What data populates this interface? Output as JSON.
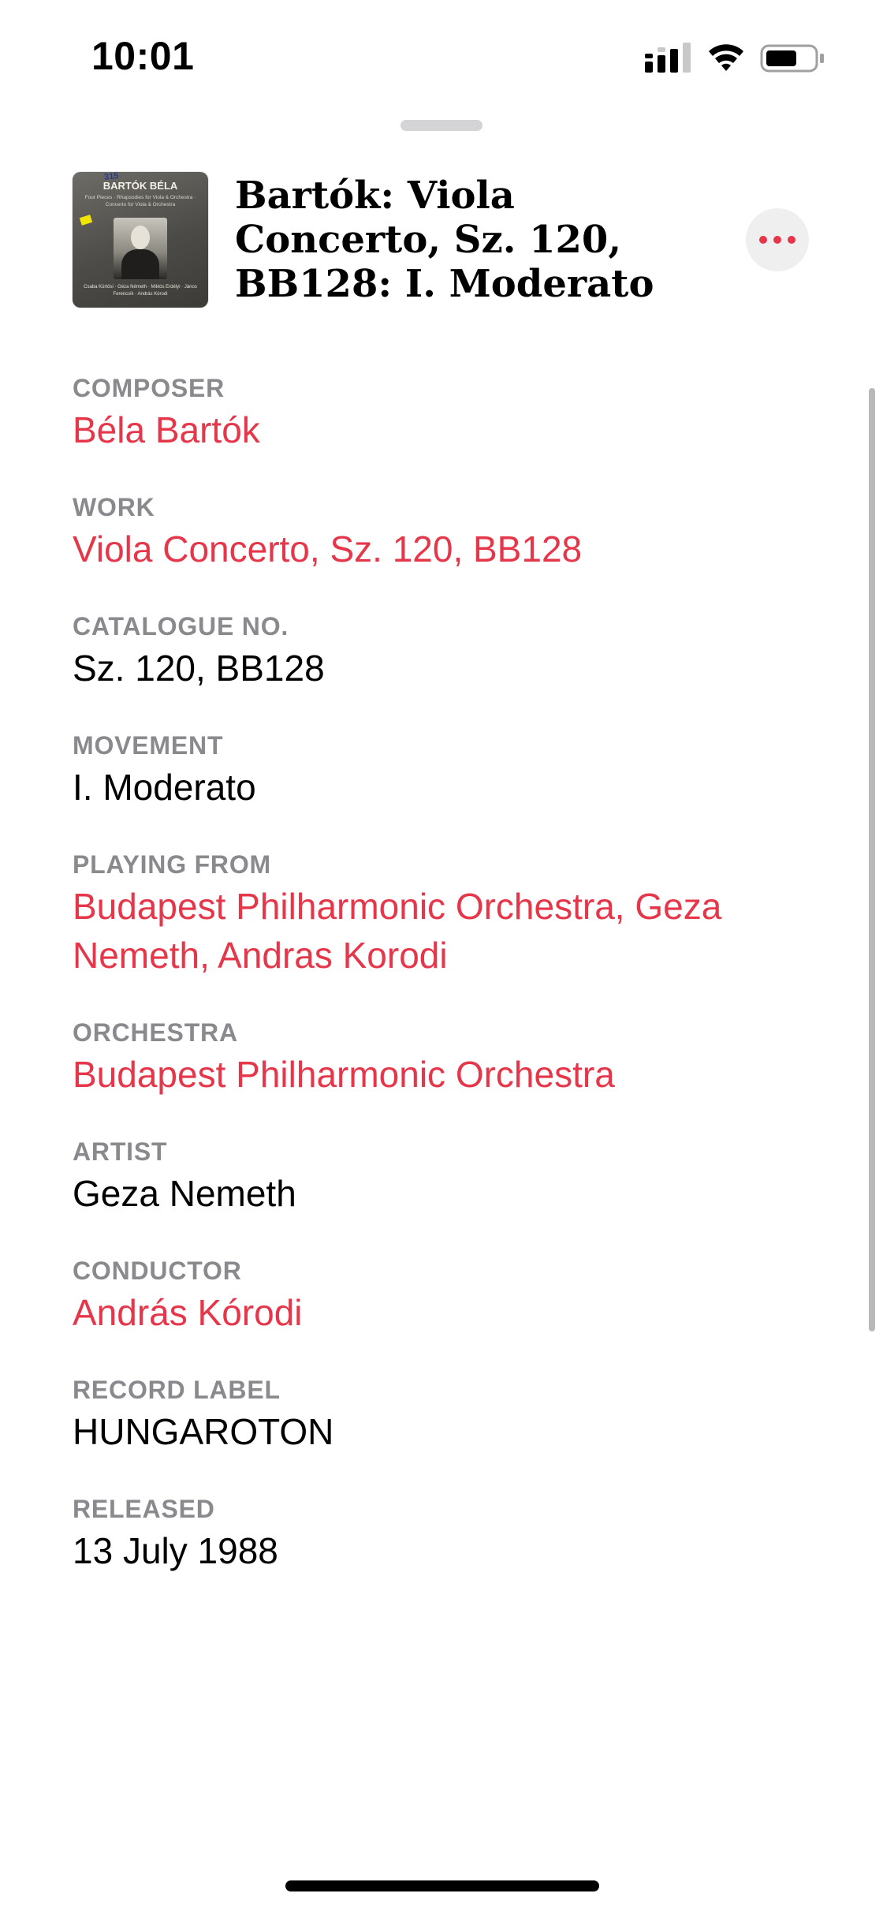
{
  "status_bar": {
    "time": "10:01",
    "icons": [
      "cellular-signal-icon",
      "wifi-icon",
      "battery-icon"
    ]
  },
  "artwork": {
    "header_text": "BARTÓK BÉLA",
    "sub_text": "Four Pieces · Rhapsodies for Viola & Orchestra · Concerto for Viola & Orchestra",
    "credits_text": "Csaba Kürtösi · Géza Németh · Miklós Erdélyi · János Ferencsik · András Kórodi",
    "scribble": "315"
  },
  "header": {
    "title": "Bartók: Viola Concerto, Sz. 120, BB128: I. Moderato",
    "more_button_icon": "ellipsis-icon"
  },
  "details": [
    {
      "label": "COMPOSER",
      "value": "Béla Bartók",
      "is_link": true
    },
    {
      "label": "WORK",
      "value": "Viola Concerto, Sz. 120, BB128",
      "is_link": true
    },
    {
      "label": "CATALOGUE NO.",
      "value": "Sz. 120, BB128",
      "is_link": false
    },
    {
      "label": "MOVEMENT",
      "value": "I. Moderato",
      "is_link": false
    },
    {
      "label": "PLAYING FROM",
      "value": "Budapest Philharmonic Orchestra, Geza Nemeth, Andras Korodi",
      "is_link": true
    },
    {
      "label": "ORCHESTRA",
      "value": "Budapest Philharmonic Orchestra",
      "is_link": true
    },
    {
      "label": "ARTIST",
      "value": "Geza Nemeth",
      "is_link": false
    },
    {
      "label": "CONDUCTOR",
      "value": "András Kórodi",
      "is_link": true
    },
    {
      "label": "RECORD LABEL",
      "value": "HUNGAROTON",
      "is_link": false
    },
    {
      "label": "RELEASED",
      "value": "13 July 1988",
      "is_link": false
    }
  ],
  "colors": {
    "accent": "#e5364a",
    "label_gray": "#8a8a8e",
    "text": "#000000",
    "background": "#ffffff"
  }
}
